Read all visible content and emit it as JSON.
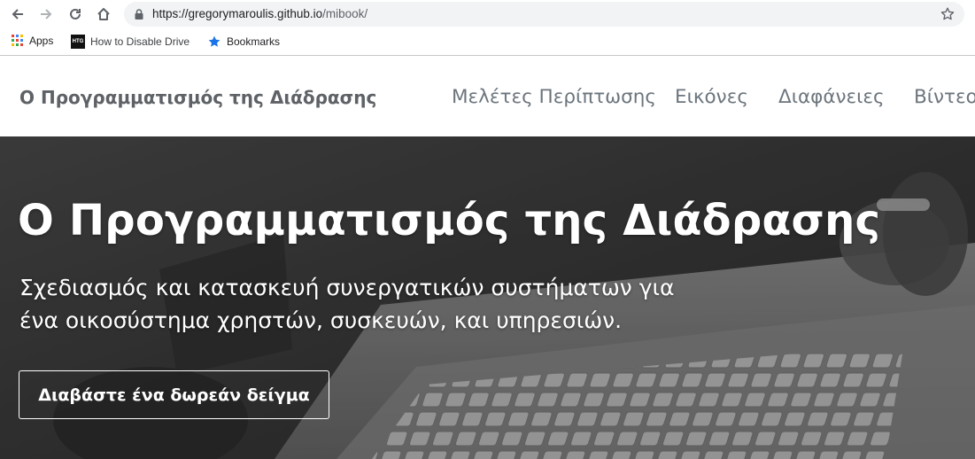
{
  "browser": {
    "url_host": "https://gregorymaroulis.github.io",
    "url_path": "/mibook/",
    "bookmarks": [
      {
        "label": "Apps",
        "icon": "apps-grid-icon"
      },
      {
        "label": "How to Disable Drive",
        "icon": "htg-favicon",
        "icon_text": "HTG"
      },
      {
        "label": "Bookmarks",
        "icon": "star-icon"
      }
    ]
  },
  "site": {
    "brand": "Ο Προγραμματισμός της Διάδρασης",
    "nav": [
      {
        "label": "Μελέτες Περίπτωσης"
      },
      {
        "label": "Εικόνες"
      },
      {
        "label": "Διαφάνειες"
      },
      {
        "label": "Βίντεο"
      }
    ]
  },
  "hero": {
    "title": "Ο Προγραμματισμός της Διάδρασης",
    "subtitle_line1": "Σχεδιασμός και κατασκευή συνεργατικών συστήματων για",
    "subtitle_line2": "ένα οικοσύστημα χρηστών, συσκευών, και υπηρεσιών.",
    "cta": "Διαβάστε ένα δωρεάν δείγμα"
  },
  "colors": {
    "brand_text": "#5e6266",
    "nav_text": "#6c757d",
    "omnibox": "#f1f3f4",
    "bookmark_star": "#1a73e8"
  }
}
